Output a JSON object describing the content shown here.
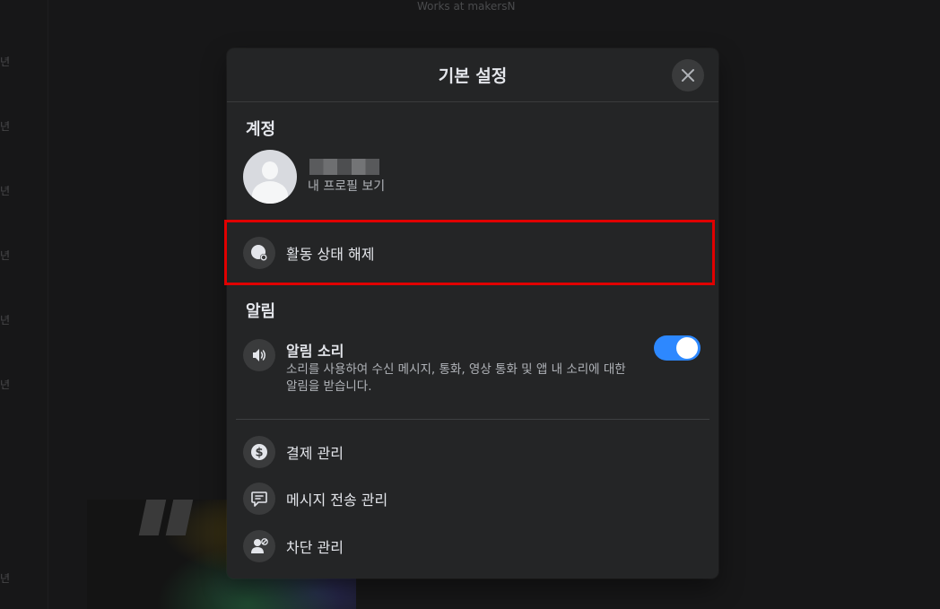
{
  "background": {
    "subtitle": "Works at makersN",
    "year_marker": "년"
  },
  "modal": {
    "title": "기본 설정",
    "close_icon": "close-icon"
  },
  "account": {
    "section_title": "계정",
    "profile_link": "내 프로필 보기"
  },
  "activity": {
    "label": "활동 상태 해제",
    "icon": "active-status-icon"
  },
  "notifications": {
    "section_title": "알림",
    "sound": {
      "title": "알림 소리",
      "description": "소리를 사용하여 수신 메시지, 통화, 영상 통화 및 앱 내 소리에 대한 알림을 받습니다.",
      "enabled": true,
      "icon": "speaker-icon"
    }
  },
  "menu": [
    {
      "label": "결제 관리",
      "icon": "dollar-icon"
    },
    {
      "label": "메시지 전송 관리",
      "icon": "message-icon"
    },
    {
      "label": "차단 관리",
      "icon": "block-user-icon"
    }
  ],
  "colors": {
    "modal_bg": "#242526",
    "toggle_on": "#2d88ff",
    "highlight_border": "#e00000"
  }
}
